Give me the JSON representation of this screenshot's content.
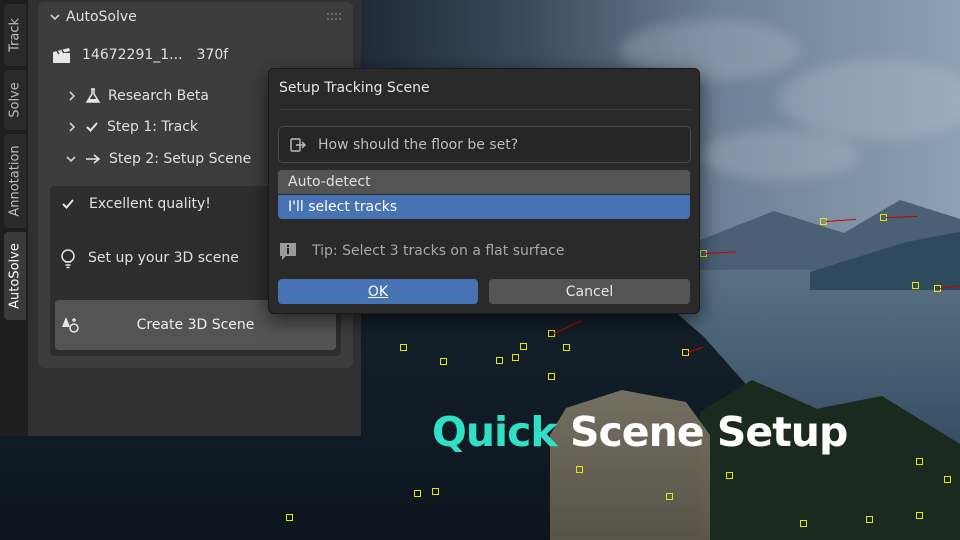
{
  "headline": {
    "accent": "Quick",
    "rest": " Scene Setup"
  },
  "tabs": [
    {
      "label": "Track"
    },
    {
      "label": "Solve"
    },
    {
      "label": "Annotation"
    },
    {
      "label": "AutoSolve"
    }
  ],
  "panel": {
    "title": "AutoSolve",
    "clip": {
      "name": "14672291_1...",
      "frames": "370f"
    },
    "sections": [
      {
        "label": "Research Beta"
      },
      {
        "label": "Step 1: Track"
      },
      {
        "label": "Step 2: Setup Scene"
      }
    ],
    "quality": "Excellent quality!",
    "setup_hint": "Set up your 3D scene",
    "create_button": "Create 3D Scene"
  },
  "dialog": {
    "title": "Setup Tracking Scene",
    "question": "How should the floor be set?",
    "options": [
      {
        "label": "Auto-detect",
        "selected": false
      },
      {
        "label": "I'll select tracks",
        "selected": true
      }
    ],
    "tip": "Tip: Select 3 tracks on a flat surface",
    "ok_label": "OK",
    "cancel_label": "Cancel"
  },
  "colors": {
    "accent": "#2fe0c4",
    "selection": "#4772b3",
    "track_marker": "#e6e600",
    "track_line": "#cc0000"
  }
}
